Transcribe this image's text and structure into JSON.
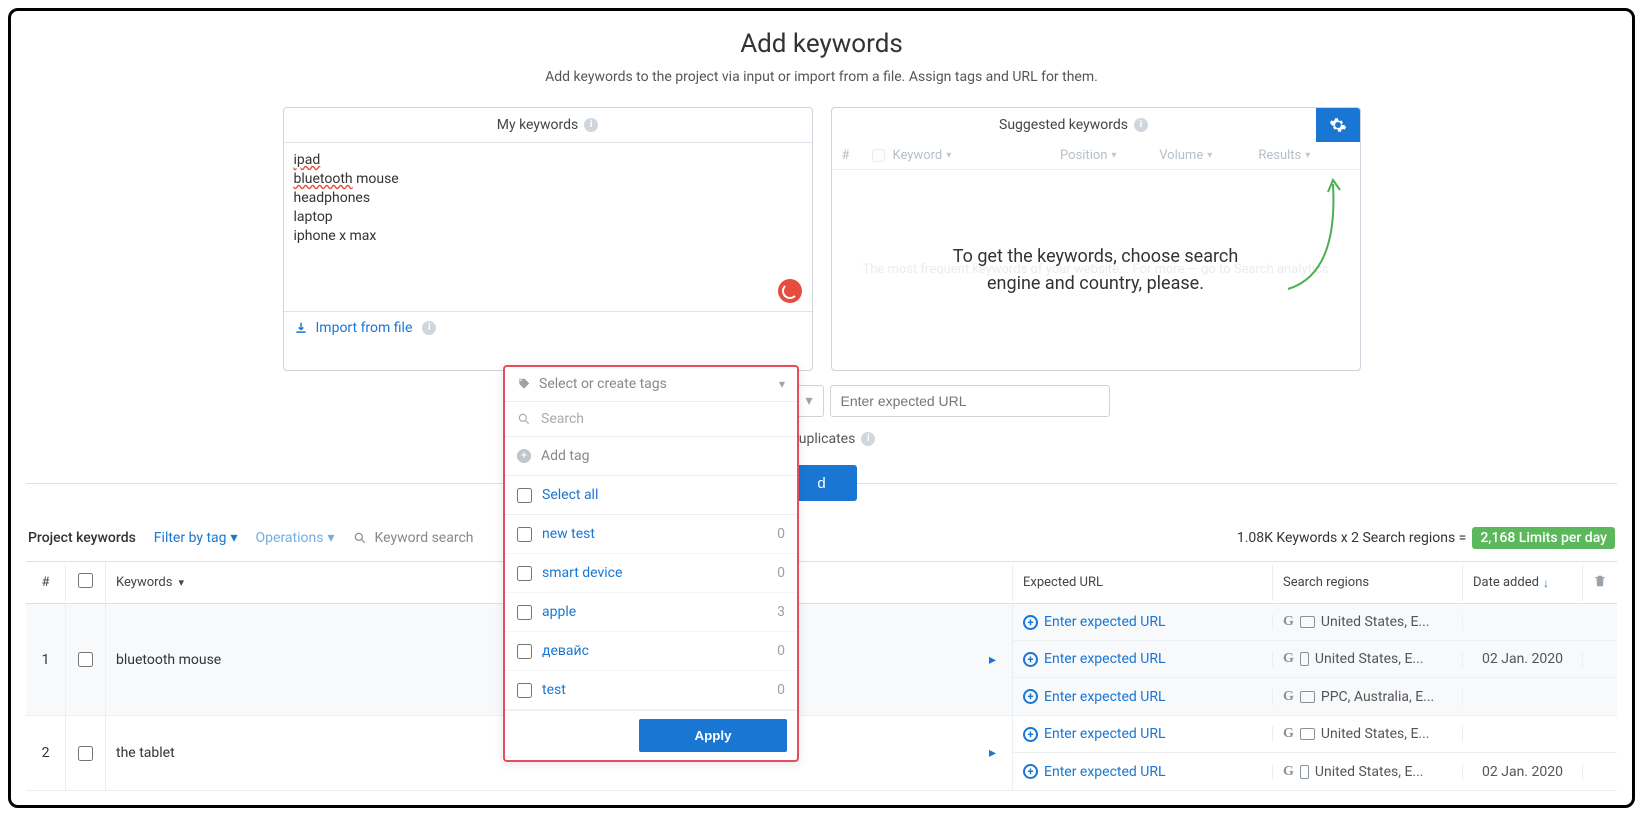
{
  "header": {
    "title": "Add keywords",
    "subtitle": "Add keywords to the project via input or import from a file. Assign tags and URL for them."
  },
  "my_keywords": {
    "title": "My keywords",
    "textarea_value": "ipad\nbluetooth mouse\nheadphones\nlaptop\niphone x max",
    "import_label": "Import from file"
  },
  "suggested": {
    "title": "Suggested keywords",
    "columns": {
      "num": "#",
      "keyword": "Keyword",
      "position": "Position",
      "volume": "Volume",
      "results": "Results"
    },
    "empty_message": "To get the keywords, choose search engine and country, please.",
    "bg_text": "The most frequent keywords of your website... For more — go to Search analytics"
  },
  "tag_select": {
    "placeholder": "Select or create tags"
  },
  "url_input": {
    "placeholder": "Enter expected URL"
  },
  "duplicates": {
    "text_right": "rds duplicates"
  },
  "add_button_visible_text": "d",
  "dropdown": {
    "search_placeholder": "Search",
    "add_tag_label": "Add tag",
    "select_all_label": "Select all",
    "items": [
      {
        "label": "new test",
        "count": "0"
      },
      {
        "label": "smart device",
        "count": "0"
      },
      {
        "label": "apple",
        "count": "3"
      },
      {
        "label": "девайс",
        "count": "0"
      },
      {
        "label": "test",
        "count": "0"
      }
    ],
    "apply_label": "Apply"
  },
  "toolbar": {
    "project_keywords": "Project keywords",
    "filter_by_tag": "Filter by tag",
    "operations": "Operations",
    "keyword_search": "Keyword search",
    "summary_prefix": "1.08K Keywords x 2 Search regions =",
    "limits_badge": "2,168 Limits per day"
  },
  "grid": {
    "columns": {
      "num": "#",
      "keywords": "Keywords",
      "expected_url": "Expected URL",
      "search_regions": "Search regions",
      "date_added": "Date added"
    },
    "enter_url": "Enter expected URL",
    "rows": [
      {
        "num": "1",
        "keyword": "bluetooth mouse",
        "date": "02 Jan. 2020",
        "subrows": [
          {
            "region": "United States, E...",
            "device": "desktop"
          },
          {
            "region": "United States, E...",
            "device": "mobile"
          },
          {
            "region": "PPC, Australia, E...",
            "device": "desktop"
          }
        ]
      },
      {
        "num": "2",
        "keyword": "the tablet",
        "date": "02 Jan. 2020",
        "subrows": [
          {
            "region": "United States, E...",
            "device": "desktop"
          },
          {
            "region": "United States, E...",
            "device": "mobile"
          }
        ]
      }
    ]
  }
}
